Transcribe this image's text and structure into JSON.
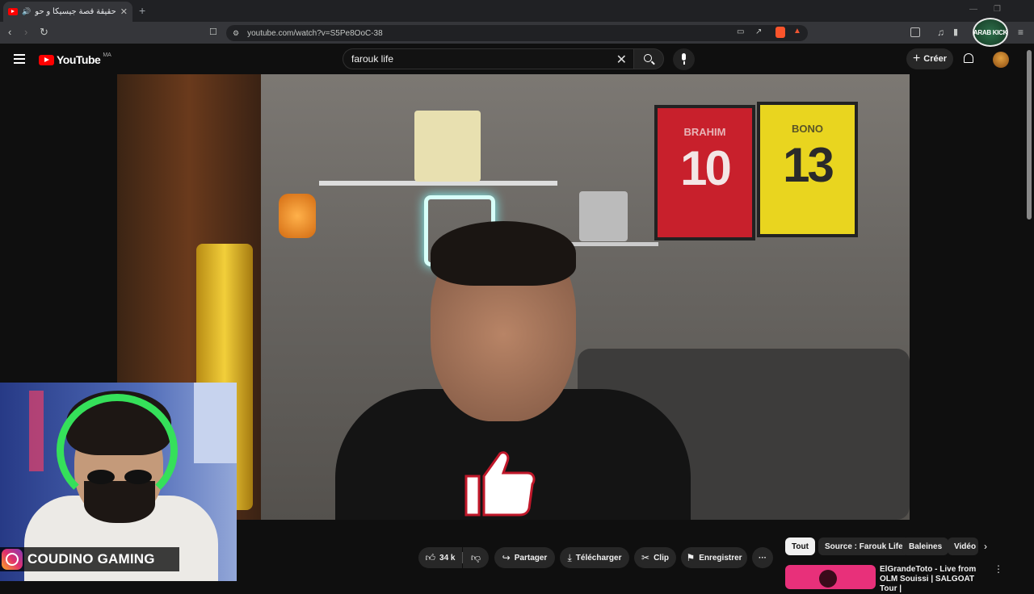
{
  "browser": {
    "tab_title": "حقيقة قصة جيسيكا و حوت الأ...",
    "new_tab": "+",
    "url": "youtube.com/watch?v=S5Pe8OoC-38"
  },
  "youtube": {
    "logo_text": "YouTube",
    "country_code": "MA",
    "search_value": "farouk life",
    "create_label": "Créer"
  },
  "video": {
    "jersey_1_name": "BRAHIM",
    "jersey_1_number": "10",
    "jersey_2_name": "BONO",
    "jersey_2_number": "13"
  },
  "actions": {
    "like_count": "34 k",
    "share_label": "Partager",
    "download_label": "Télécharger",
    "clip_label": "Clip",
    "save_label": "Enregistrer",
    "more_label": "···"
  },
  "filters": [
    "Tout",
    "Source : Farouk Life",
    "Baleines",
    "Vidéo"
  ],
  "recommendation": {
    "title": "ElGrandeToto  - Live from OLM Souissi | SALGOAT Tour |"
  },
  "streamer": {
    "name": "COUDINO GAMING"
  },
  "watermark": {
    "text": "ARAB KICK"
  },
  "colors": {
    "youtube_red": "#ff0000",
    "background": "#0f0f0f",
    "chip": "#272727"
  }
}
